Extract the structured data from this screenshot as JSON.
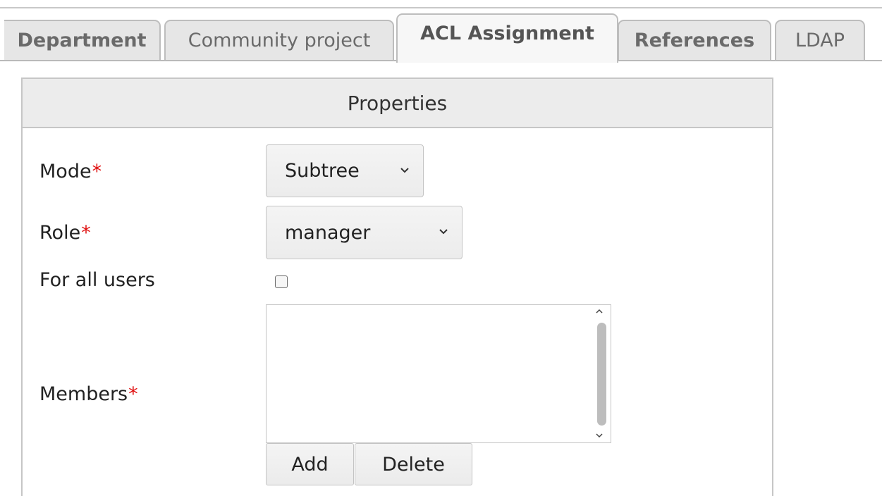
{
  "tabs": [
    {
      "label": "Department",
      "active": false
    },
    {
      "label": "Community project",
      "active": false
    },
    {
      "label": "ACL Assignment",
      "active": true
    },
    {
      "label": "References",
      "active": false
    },
    {
      "label": "LDAP",
      "active": false
    }
  ],
  "panel": {
    "title": "Properties",
    "fields": {
      "mode": {
        "label": "Mode",
        "required_mark": "*",
        "value": "Subtree"
      },
      "role": {
        "label": "Role",
        "required_mark": "*",
        "value": "manager"
      },
      "for_all_users": {
        "label": "For all users",
        "checked": false
      },
      "members": {
        "label": "Members",
        "required_mark": "*",
        "items": []
      }
    },
    "buttons": {
      "add": "Add",
      "delete": "Delete"
    }
  },
  "colors": {
    "required": "#e01010",
    "tab_background": "#e6e6e6",
    "active_tab_background": "#f7f7f7",
    "header_background": "#ececec"
  }
}
